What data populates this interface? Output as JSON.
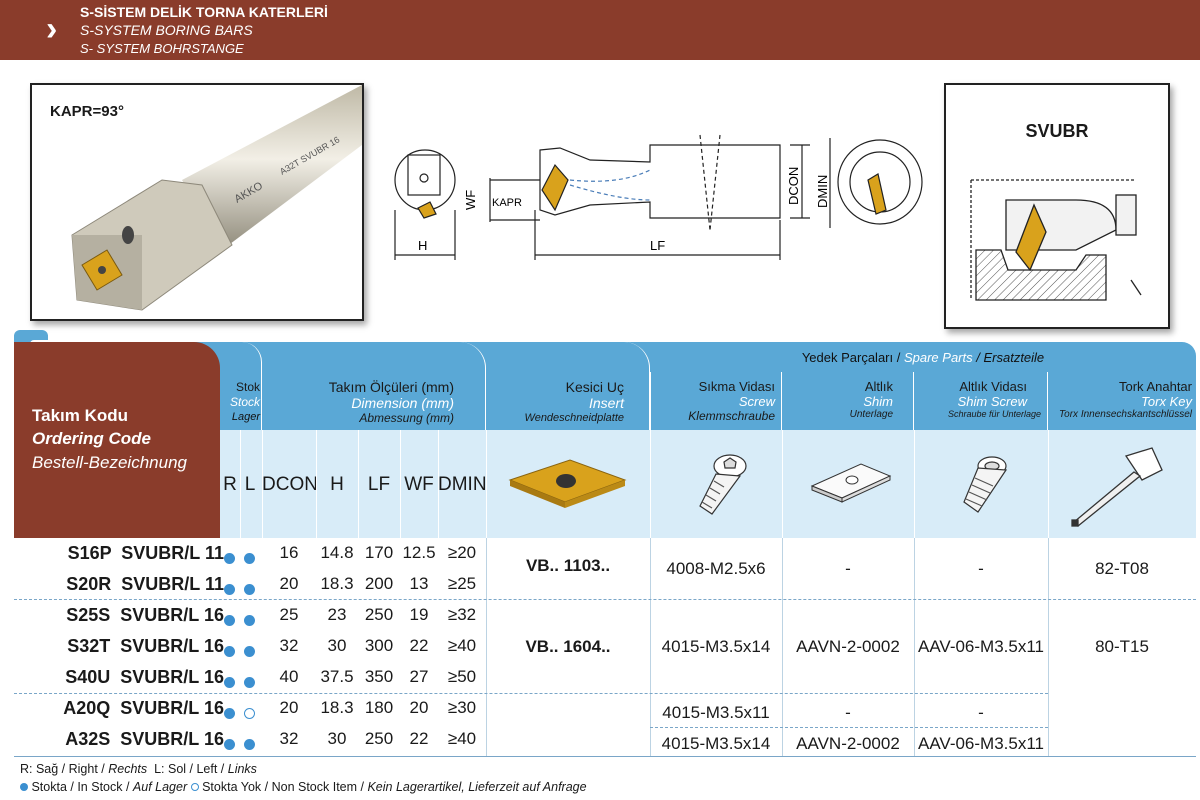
{
  "header": {
    "title_tr": "S-SİSTEM DELİK TORNA KATERLERİ",
    "title_en": "S-SYSTEM BORING BARS",
    "title_de": "S- SYSTEM BOHRSTANGE"
  },
  "photo": {
    "kapr_label": "KAPR=93°",
    "bar_brand": "AKKO",
    "bar_marking": "A32T SVUBR 16"
  },
  "drawing": {
    "h": "H",
    "wf": "WF",
    "kapr": "KAPR",
    "lf": "LF",
    "dcon": "DCON",
    "dmin": "DMIN"
  },
  "svubr_box": {
    "title": "SVUBR"
  },
  "table": {
    "spare_parts_title": {
      "tr": "Yedek Parçaları /",
      "en": "Spare Parts",
      "de": "/ Ersatzteile"
    },
    "ordering_code": {
      "tr": "Takım Kodu",
      "en": "Ordering Code",
      "de": "Bestell-Bezeichnung"
    },
    "stock": {
      "tr": "Stok",
      "en": "Stock",
      "de": "Lager"
    },
    "dimension": {
      "tr": "Takım Ölçüleri (mm)",
      "en": "Dimension (mm)",
      "de": "Abmessung (mm)"
    },
    "insert": {
      "tr": "Kesici Uç",
      "en": "Insert",
      "de": "Wendeschneidplatte"
    },
    "screw": {
      "tr": "Sıkma Vidası",
      "en": "Screw",
      "de": "Klemmschraube"
    },
    "shim": {
      "tr": "Altlık",
      "en": "Shim",
      "de": "Unterlage"
    },
    "shim_screw": {
      "tr": "Altlık Vidası",
      "en": "Shim Screw",
      "de": "Schraube für Unterlage"
    },
    "torx_key": {
      "tr": "Tork Anahtar",
      "en": "Torx Key",
      "de": "Torx Innensechskantschlüssel"
    },
    "columns": [
      "R",
      "L",
      "DCON",
      "H",
      "LF",
      "WF",
      "DMIN"
    ],
    "rows": [
      {
        "code": "S16P  SVUBR/L 11",
        "r": "stock",
        "l": "stock",
        "dcon": "16",
        "h": "14.8",
        "lf": "170",
        "wf": "12.5",
        "dmin": "≥20"
      },
      {
        "code": "S20R  SVUBR/L 11",
        "r": "stock",
        "l": "stock",
        "dcon": "20",
        "h": "18.3",
        "lf": "200",
        "wf": "13",
        "dmin": "≥25"
      },
      {
        "code": "S25S  SVUBR/L 16",
        "r": "stock",
        "l": "stock",
        "dcon": "25",
        "h": "23",
        "lf": "250",
        "wf": "19",
        "dmin": "≥32"
      },
      {
        "code": "S32T  SVUBR/L 16",
        "r": "stock",
        "l": "stock",
        "dcon": "32",
        "h": "30",
        "lf": "300",
        "wf": "22",
        "dmin": "≥40"
      },
      {
        "code": "S40U  SVUBR/L 16",
        "r": "stock",
        "l": "stock",
        "dcon": "40",
        "h": "37.5",
        "lf": "350",
        "wf": "27",
        "dmin": "≥50"
      },
      {
        "code": "A20Q  SVUBR/L 16",
        "r": "stock",
        "l": "nonstock",
        "dcon": "20",
        "h": "18.3",
        "lf": "180",
        "wf": "20",
        "dmin": "≥30"
      },
      {
        "code": "A32S  SVUBR/L 16",
        "r": "stock",
        "l": "stock",
        "dcon": "32",
        "h": "30",
        "lf": "250",
        "wf": "22",
        "dmin": "≥40"
      }
    ],
    "groups": {
      "g1": {
        "insert": "VB.. 1103..",
        "screw": "4008-M2.5x6",
        "shim": "-",
        "shim_screw": "-",
        "key": "82-T08"
      },
      "g2": {
        "insert": "VB.. 1604..",
        "screw": "4015-M3.5x14",
        "shim": "AAVN-2-0002",
        "shim_screw": "AAV-06-M3.5x11",
        "key": "80-T15"
      },
      "g3": {
        "screw": "4015-M3.5x11",
        "shim": "-",
        "shim_screw": "-"
      },
      "g4": {
        "screw": "4015-M3.5x14",
        "shim": "AAVN-2-0002",
        "shim_screw": "AAV-06-M3.5x11"
      }
    }
  },
  "footer": {
    "line1": {
      "a": "R: Sağ / Right / ",
      "a_it": "Rechts",
      "b": "  L: Sol / Left / ",
      "b_it": "Links"
    },
    "line2": {
      "a": " Stokta / In Stock / ",
      "a_it": "Auf Lager",
      "b": " Stokta Yok / Non Stock Item / ",
      "b_it": "Kein Lagerartikel, Lieferzeit auf Anfrage"
    }
  },
  "colors": {
    "header": "#8a3c2b",
    "blue": "#5aa8d6",
    "light_blue": "#d8ecf8",
    "stock_dot": "#3b8fd0",
    "insert_gold": "#d9a21c"
  }
}
